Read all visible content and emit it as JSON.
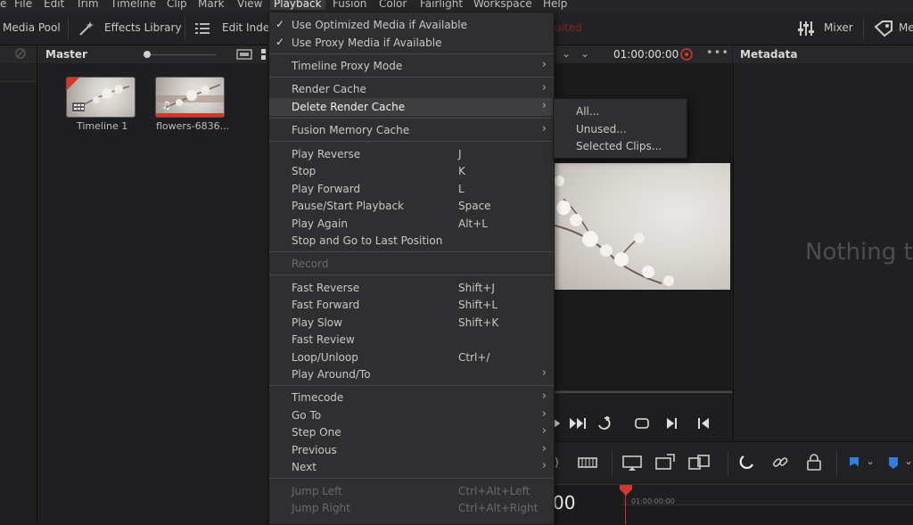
{
  "menubar": {
    "items": [
      "e",
      "File",
      "Edit",
      "Trim",
      "Timeline",
      "Clip",
      "Mark",
      "View",
      "Playback",
      "Fusion",
      "Color",
      "Fairlight",
      "Workspace",
      "Help"
    ]
  },
  "toolbar": {
    "media_pool": "Media Pool",
    "effects_library": "Effects Library",
    "edit_index": "Edit Index",
    "mixer": "Mixer",
    "meta_partial": "Me",
    "hidden_partial": "uited"
  },
  "pool": {
    "title": "Master",
    "clips": [
      {
        "label": "Timeline 1"
      },
      {
        "label": "flowers-6836..."
      }
    ]
  },
  "viewer": {
    "timecode": "01:00:00:00"
  },
  "metadata": {
    "title": "Metadata",
    "empty_text": "Nothing t"
  },
  "timeline": {
    "timecode_partial": "00",
    "ruler_label": "01:00:00:00"
  },
  "playback_menu": {
    "items": [
      {
        "label": "Use Optimized Media if Available",
        "checked": true
      },
      {
        "label": "Use Proxy Media if Available",
        "checked": true
      },
      {
        "label": "Timeline Proxy Mode",
        "submenu": true
      },
      {
        "label": "Render Cache",
        "submenu": true
      },
      {
        "label": "Delete Render Cache",
        "submenu": true,
        "highlighted": true
      },
      {
        "label": "Fusion Memory Cache",
        "submenu": true
      },
      {
        "label": "Play Reverse",
        "shortcut": "J"
      },
      {
        "label": "Stop",
        "shortcut": "K"
      },
      {
        "label": "Play Forward",
        "shortcut": "L"
      },
      {
        "label": "Pause/Start Playback",
        "shortcut": "Space"
      },
      {
        "label": "Play Again",
        "shortcut": "Alt+L"
      },
      {
        "label": "Stop and Go to Last Position"
      },
      {
        "label": "Record",
        "disabled": true
      },
      {
        "label": "Fast Reverse",
        "shortcut": "Shift+J"
      },
      {
        "label": "Fast Forward",
        "shortcut": "Shift+L"
      },
      {
        "label": "Play Slow",
        "shortcut": "Shift+K"
      },
      {
        "label": "Fast Review"
      },
      {
        "label": "Loop/Unloop",
        "shortcut": "Ctrl+/"
      },
      {
        "label": "Play Around/To",
        "submenu": true
      },
      {
        "label": "Timecode",
        "submenu": true
      },
      {
        "label": "Go To",
        "submenu": true
      },
      {
        "label": "Step One",
        "submenu": true
      },
      {
        "label": "Previous",
        "submenu": true
      },
      {
        "label": "Next",
        "submenu": true
      },
      {
        "label": "Jump Left",
        "shortcut": "Ctrl+Alt+Left",
        "disabled": true
      },
      {
        "label": "Jump Right",
        "shortcut": "Ctrl+Alt+Right",
        "disabled": true
      }
    ]
  },
  "submenu": {
    "items": [
      "All...",
      "Unused...",
      "Selected Clips..."
    ]
  },
  "colors": {
    "accent_red": "#d9352b",
    "marker_blue": "#2f7fe0",
    "menu_bg": "#2f2f31"
  }
}
